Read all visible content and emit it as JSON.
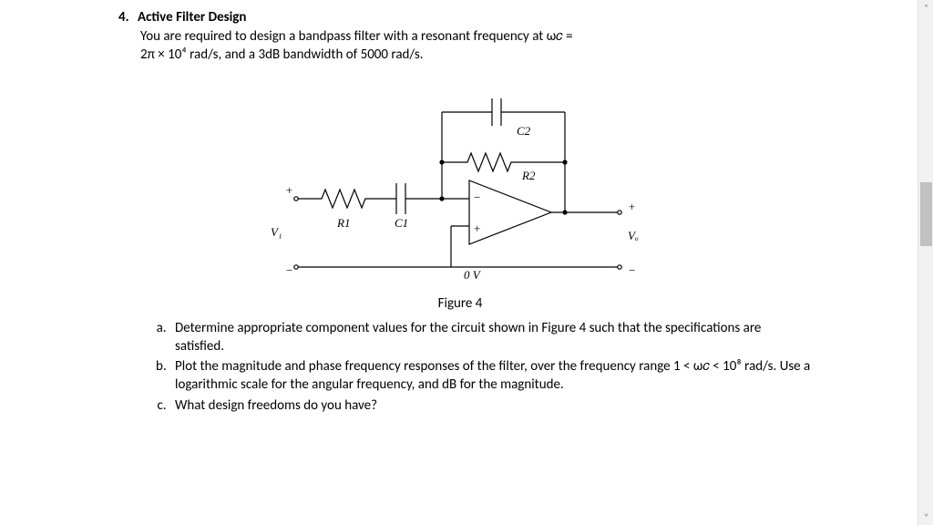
{
  "question": {
    "number": "4.",
    "title": "Active Filter Design",
    "line1": "You are required to design a bandpass filter with a resonant frequency at ω𝑐 =",
    "line2": "2π × 10⁴ rad/s, and a 3dB bandwidth of 5000 rad/s."
  },
  "circuit": {
    "vin_plus": "+",
    "vin_minus": "−",
    "vin_label": "V₁",
    "r1": "R1",
    "c1": "C1",
    "c2": "C2",
    "r2": "R2",
    "opamp_plus": "+",
    "opamp_minus": "−",
    "vout_plus": "+",
    "vout_minus": "−",
    "vout_label": "Vₒ",
    "ground": "0 V",
    "caption": "Figure 4"
  },
  "parts": {
    "a": "Determine appropriate component values for the circuit shown in Figure 4 such that the specifications are satisfied.",
    "b": "Plot the magnitude and phase frequency responses of the filter, over the frequency range 1 < ω𝑐 < 10⁸ rad/s. Use a logarithmic scale for the angular frequency, and dB for the magnitude.",
    "c": "What design freedoms do you have?"
  },
  "scrollbar": {
    "up": "˄",
    "down": "˅"
  }
}
